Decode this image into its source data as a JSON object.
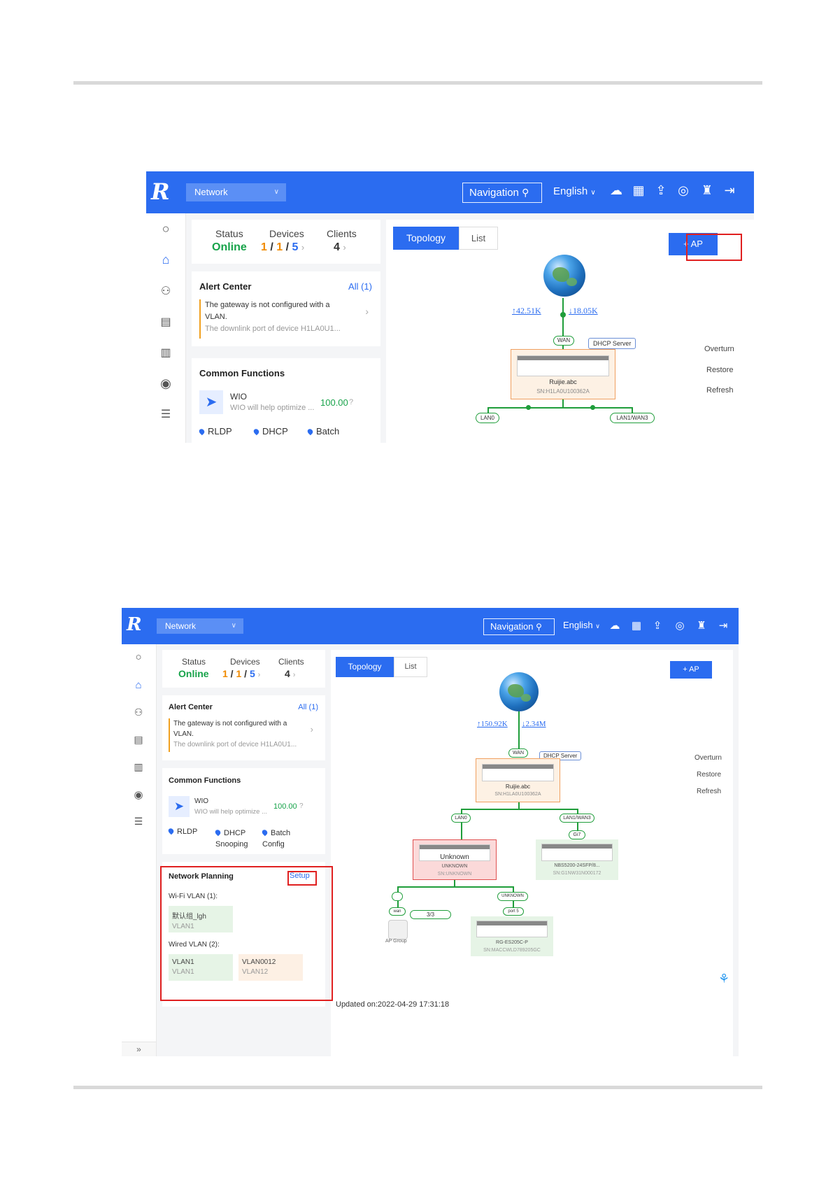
{
  "shot1": {
    "header": {
      "network_select": "Network",
      "navigation_label": "Navigation",
      "language": "English"
    },
    "summary": {
      "status_label": "Status",
      "status_value": "Online",
      "devices_label": "Devices",
      "devices_v1": "1",
      "devices_v2": "1",
      "devices_v3": "5",
      "clients_label": "Clients",
      "clients_value": "4"
    },
    "alert_center": {
      "title": "Alert Center",
      "all_link": "All (1)",
      "line1": "The gateway is not configured with a",
      "line2": "VLAN.",
      "line3": "The downlink port of device H1LA0U1..."
    },
    "common_functions": {
      "title": "Common Functions",
      "wio_title": "WIO",
      "wio_desc": "WIO will help optimize ...",
      "wio_score": "100.00",
      "items": [
        "RLDP",
        "DHCP",
        "Batch"
      ]
    },
    "topology": {
      "tab_topology": "Topology",
      "tab_list": "List",
      "ap_button": "+ AP",
      "upload": "↑42.51K",
      "download": "↓18.05K",
      "wan_label": "WAN",
      "dhcp_label": "DHCP Server",
      "gateway_name": "Ruijie.abc",
      "gateway_sn": "SN:H1LA0U100362A",
      "port_left": "LAN0",
      "port_right": "LAN1/WAN3",
      "actions": [
        "Overturn",
        "Restore",
        "Refresh"
      ]
    }
  },
  "shot2": {
    "header": {
      "network_select": "Network",
      "navigation_label": "Navigation",
      "language": "English"
    },
    "summary": {
      "status_label": "Status",
      "status_value": "Online",
      "devices_label": "Devices",
      "devices_v1": "1",
      "devices_v2": "1",
      "devices_v3": "5",
      "clients_label": "Clients",
      "clients_value": "4"
    },
    "alert_center": {
      "title": "Alert Center",
      "all_link": "All (1)",
      "line1": "The gateway is not configured with a",
      "line2": "VLAN.",
      "line3": "The downlink port of device H1LA0U1..."
    },
    "common_functions": {
      "title": "Common Functions",
      "wio_title": "WIO",
      "wio_desc": "WIO will help optimize ...",
      "wio_score": "100.00",
      "item1": "RLDP",
      "item2_l1": "DHCP",
      "item2_l2": "Snooping",
      "item3_l1": "Batch",
      "item3_l2": "Config"
    },
    "network_planning": {
      "title": "Network Planning",
      "setup": "Setup",
      "wifi_vlan_label": "Wi-Fi VLAN (1):",
      "wifi_vlan_name": "默认组_lgh",
      "wifi_vlan_id": "VLAN1",
      "wired_vlan_label": "Wired VLAN (2):",
      "wired1_name": "VLAN1",
      "wired1_id": "VLAN1",
      "wired2_name": "VLAN0012",
      "wired2_id": "VLAN12"
    },
    "topology": {
      "tab_topology": "Topology",
      "tab_list": "List",
      "ap_button": "+ AP",
      "upload": "↑150.92K",
      "download": "↓2.34M",
      "wan_label": "WAN",
      "dhcp_label": "DHCP Server",
      "gateway_name": "Ruijie.abc",
      "gateway_sn": "SN:H1LA0U100362A",
      "port_lan0": "LAN0",
      "port_lan1": "LAN1/WAN3",
      "port_gi7": "Gi7",
      "unknown_title": "Unknown",
      "unknown_name": "UNKNOWN",
      "unknown_sn": "SN:UNKNOWN",
      "switch_name": "NBS5200-24SFP/8...",
      "switch_sn": "SN:G1NW31N000172",
      "port_small": "",
      "port_wan": "wan",
      "ap_count": "3/3",
      "ap_group": "AP Group",
      "port_unknown": "UNKNOWN",
      "port5": "port 5",
      "rg_name": "RG-ES205C-P",
      "rg_sn": "SN:MACCWLD789205GC",
      "actions": [
        "Overturn",
        "Restore",
        "Refresh"
      ],
      "updated": "Updated on:2022-04-29 17:31:18"
    },
    "collapse_label": "»"
  }
}
